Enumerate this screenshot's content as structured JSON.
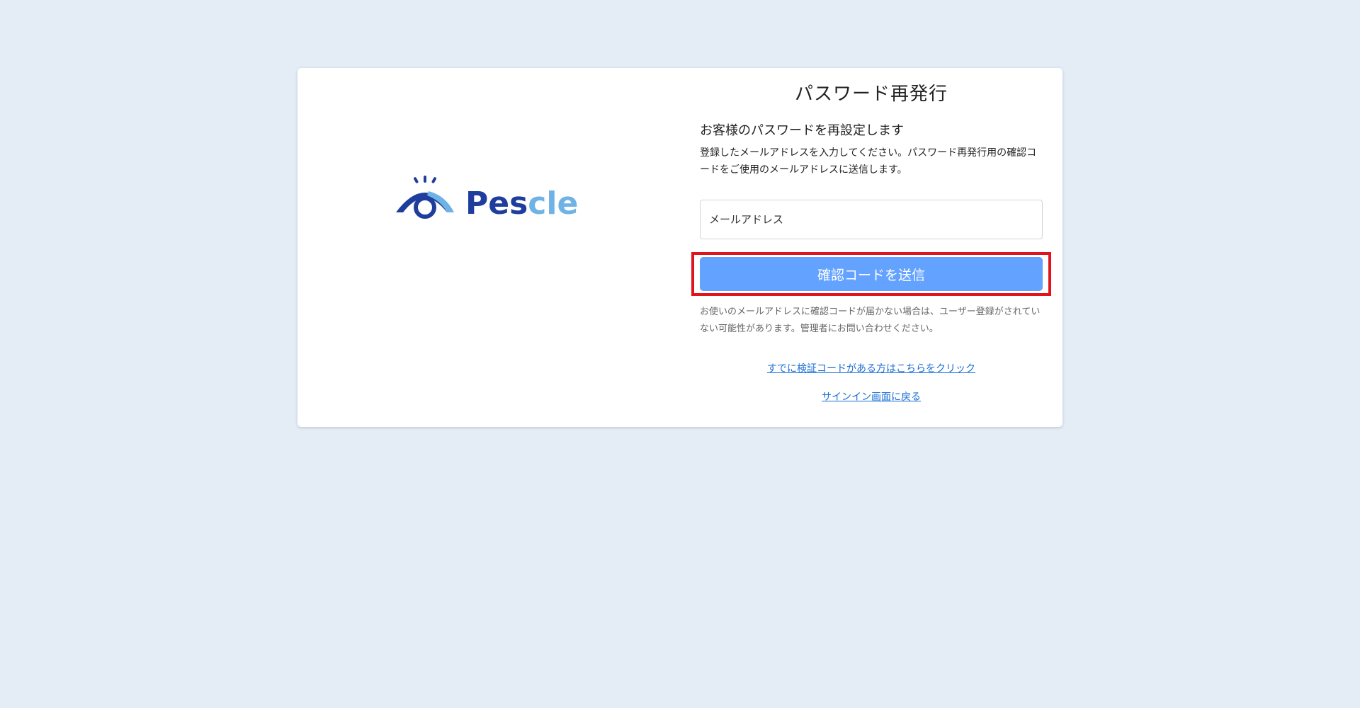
{
  "logo": {
    "text": "Pescle",
    "colors": {
      "primary": "#1f3d9c",
      "accent": "#6fb3e6"
    }
  },
  "page": {
    "title": "パスワード再発行",
    "subtitle": "お客様のパスワードを再設定します",
    "description": "登録したメールアドレスを入力してください。パスワード再発行用の確認コードをご使用のメールアドレスに送信します。"
  },
  "form": {
    "email_placeholder": "メールアドレス",
    "email_value": "",
    "send_label": "確認コードを送信"
  },
  "note": "お使いのメールアドレスに確認コードが届かない場合は、ユーザー登録がされていない可能性があります。管理者にお問い合わせください。",
  "links": {
    "have_code": "すでに検証コードがある方はこちらをクリック",
    "back_to_signin": "サインイン画面に戻る"
  },
  "colors": {
    "background": "#e4ecf6",
    "button": "#63a2ff",
    "link": "#1a6fd6",
    "highlight": "#e0141e"
  }
}
